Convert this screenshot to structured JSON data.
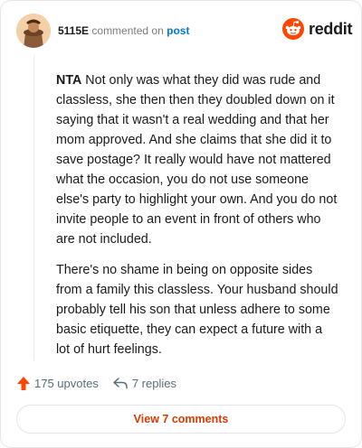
{
  "header": {
    "username": "5115E",
    "commented_text": "commented on",
    "post_link": "post"
  },
  "brand": {
    "name": "reddit",
    "color": "#ff4500"
  },
  "comment": {
    "paragraph1_lead": "NTA",
    "paragraph1_text": " Not only was what they did was rude and classless, she then then they doubled down on it saying that it wasn't a real wedding and that her mom approved. And she claims that she did it to save postage? It really would have not mattered what the occasion, you do not use someone else's party to highlight your own. And you do not invite people to an event in front of others who are not included.",
    "paragraph2": "There's no shame in being on opposite sides from a family this classless. Your husband should probably tell his son that unless adhere to some basic etiquette, they can expect a future with a lot of hurt feelings."
  },
  "actions": {
    "upvotes": "175 upvotes",
    "replies": "7 replies",
    "view_comments": "View 7 comments"
  },
  "colors": {
    "accent": "#d93a00",
    "link": "#0079d3"
  }
}
